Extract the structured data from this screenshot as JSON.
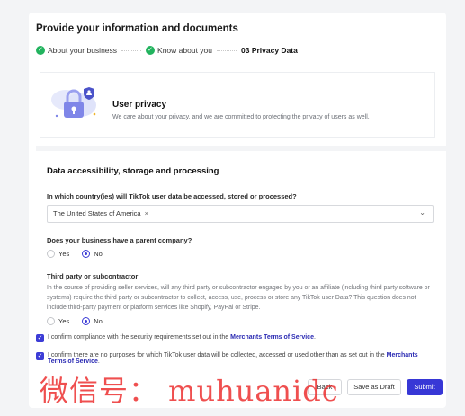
{
  "page": {
    "title": "Provide your information and documents"
  },
  "steps": [
    {
      "label": "About your business",
      "state": "done"
    },
    {
      "label": "Know about you",
      "state": "done"
    },
    {
      "label": "03 Privacy Data",
      "state": "current"
    }
  ],
  "privacy": {
    "title": "User privacy",
    "subtitle": "We care about your privacy, and we are committed to protecting the privacy of users as well."
  },
  "data_section": {
    "title": "Data accessibility, storage and processing",
    "country_question": "In which country(ies) will TikTok user data be accessed, stored or processed?",
    "country_selected": "The United States of America",
    "country_remove": "×",
    "parent_question": "Does your business have a parent company?",
    "parent_options": [
      "Yes",
      "No"
    ],
    "parent_selected": "No",
    "third_party_title": "Third party or subcontractor",
    "third_party_text": "In the course of providing seller services, will any third party or subcontractor engaged by you or an affiliate (including third party software or systems) require the third party or subcontractor to collect, access, use, process or store any TikTok user Data? This question does not include third-party payment or platform services like Shopify, PayPal or Stripe.",
    "third_party_options": [
      "Yes",
      "No"
    ],
    "third_party_selected": "No"
  },
  "confirmations": [
    {
      "text": "I confirm compliance with the security requirements set out in the",
      "link": "Merchants Terms of Service",
      "after": ".",
      "checked": true
    },
    {
      "text": "I confirm there are no purposes for which TikTok user data will be collected, accessed or used other than as set out in the",
      "link": "Merchants Terms of Service",
      "after": ".",
      "checked": true
    }
  ],
  "footer": {
    "back_label": "Back",
    "draft_label": "Save as Draft",
    "submit_label": "Submit"
  },
  "watermark": "微信号： muhuanidc",
  "colors": {
    "accent": "#3737d6",
    "success": "#22b35e",
    "watermark": "#eb1e1e"
  },
  "icons": {
    "step_done": "check-circle-icon",
    "privacy": "lock-shield-illustration",
    "dropdown": "chevron-down-icon",
    "checkbox": "checkbox-checked-icon"
  }
}
